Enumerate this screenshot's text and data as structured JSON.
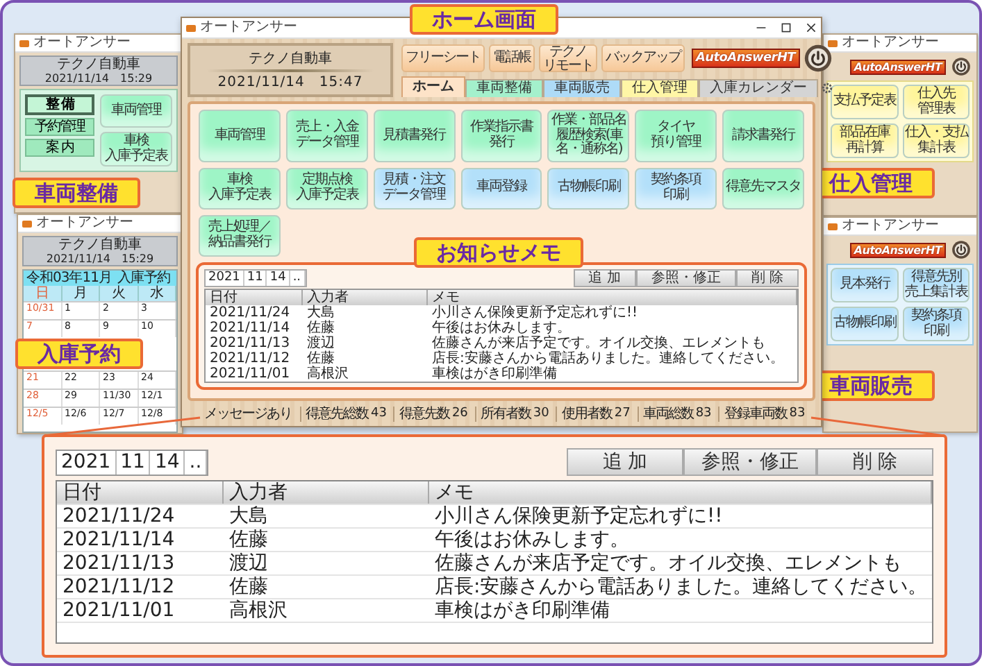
{
  "bg_windows": [
    {
      "kind": "sidebar",
      "title": "オートアンサー",
      "company": "テクノ自動車",
      "datetime": "2021/11/14　15:29",
      "menu": [
        {
          "label": "整 備",
          "selected": true
        },
        {
          "label": "予約管理",
          "selected": false
        },
        {
          "label": "案 内",
          "selected": false
        }
      ],
      "tiles": [
        {
          "lines": [
            "車両管理"
          ],
          "color": "#9ef5c6"
        },
        {
          "lines": [
            "車検",
            "入庫予定表"
          ],
          "color": "#9ef5c6"
        }
      ],
      "callout": "車両整備"
    },
    {
      "kind": "tiles",
      "title": "オートアンサー",
      "logo": "AutoAnswerHT",
      "tiles": [
        {
          "lines": [
            "支払予定表"
          ],
          "color": "#fff59a"
        },
        {
          "lines": [
            "仕入先",
            "管理表"
          ],
          "color": "#fff59a"
        },
        {
          "lines": [
            "部品在庫",
            "再計算"
          ],
          "color": "#fff59a"
        },
        {
          "lines": [
            "仕入・支払",
            "集計表"
          ],
          "color": "#fff59a"
        }
      ],
      "callout": "仕入管理"
    },
    {
      "kind": "calendar",
      "title": "オートアンサー",
      "company": "テクノ自動車",
      "datetime": "2021/11/14　15:29",
      "month": "令和03年11月",
      "label": "入庫予約",
      "weekdays": [
        "日",
        "月",
        "火",
        "水"
      ],
      "weeks": [
        [
          "10/31",
          "1",
          "2",
          "3"
        ],
        [
          "7",
          "8",
          "9",
          "10"
        ],
        [
          "21",
          "22",
          "23",
          "24"
        ],
        [
          "28",
          "29",
          "11/30",
          "12/1"
        ],
        [
          "12/5",
          "12/6",
          "12/7",
          "12/8"
        ]
      ],
      "callout": "入庫予約"
    },
    {
      "kind": "tiles",
      "title": "オートアンサー",
      "logo": "AutoAnswerHT",
      "tiles": [
        {
          "lines": [
            "見本発行"
          ],
          "color": "#b3e0fa"
        },
        {
          "lines": [
            "得意先別",
            "売上集計表"
          ],
          "color": "#b3e0fa"
        },
        {
          "lines": [
            "古物帳印刷"
          ],
          "color": "#b3e0fa"
        },
        {
          "lines": [
            "契約条項",
            "印刷"
          ],
          "color": "#b3e0fa"
        }
      ],
      "callout": "車両販売"
    }
  ],
  "main_window": {
    "callout": "ホーム画面",
    "title": "オートアンサー",
    "company": "テクノ自動車",
    "datetime": "2021/11/14　15:47",
    "toolbar_buttons": [
      [
        "フリーシート"
      ],
      [
        "電話帳"
      ],
      [
        "テクノ",
        "リモート"
      ],
      [
        "バックアップ"
      ]
    ],
    "logo": "AutoAnswerHT",
    "tabs": [
      {
        "label": "ホーム",
        "selected": true,
        "color": "#fde3c8"
      },
      {
        "label": "車両整備",
        "selected": false,
        "color": "#a4f0cc"
      },
      {
        "label": "車両販売",
        "selected": false,
        "color": "#aedbf7"
      },
      {
        "label": "仕入管理",
        "selected": false,
        "color": "#fff6a6"
      },
      {
        "label": "入庫カレンダー",
        "selected": false,
        "color": "#d4d4d4"
      }
    ],
    "tiles": [
      {
        "lines": [
          "車両管理"
        ],
        "color": "#9ef5c6"
      },
      {
        "lines": [
          "売上・入金",
          "データ管理"
        ],
        "color": "#9ef5c6"
      },
      {
        "lines": [
          "見積書発行"
        ],
        "color": "#9ef5c6"
      },
      {
        "lines": [
          "作業指示書",
          "発行"
        ],
        "color": "#9ef5c6"
      },
      {
        "lines": [
          "作業・部品名",
          "履歴検索(車",
          "名・通称名)"
        ],
        "color": "#9ef5c6"
      },
      {
        "lines": [
          "タイヤ",
          "預り管理"
        ],
        "color": "#9ef5c6"
      },
      {
        "lines": [
          "請求書発行"
        ],
        "color": "#9ef5c6"
      },
      {
        "lines": [
          "車検",
          "入庫予定表"
        ],
        "color": "#9ef5c6"
      },
      {
        "lines": [
          "定期点検",
          "入庫予定表"
        ],
        "color": "#9ef5c6"
      },
      {
        "lines": [
          "見積・注文",
          "データ管理"
        ],
        "color": "#b3e0fa"
      },
      {
        "lines": [
          "車両登録"
        ],
        "color": "#b3e0fa"
      },
      {
        "lines": [
          "古物帳印刷"
        ],
        "color": "#b3e0fa"
      },
      {
        "lines": [
          "契約条項",
          "印刷"
        ],
        "color": "#b3e0fa"
      },
      {
        "lines": [
          "得意先マスタ"
        ],
        "color": "#9ef5c6"
      },
      {
        "lines": [
          "売上処理／",
          "納品書発行"
        ],
        "color": "#9ef5c6"
      }
    ],
    "memo": {
      "callout": "お知らせメモ",
      "date_parts": [
        "2021",
        "11",
        "14",
        ".."
      ],
      "buttons": [
        "追 加",
        "参照・修正",
        "削 除"
      ],
      "columns": [
        "日付",
        "入力者",
        "メモ"
      ],
      "rows": [
        {
          "date": "2021/11/24",
          "user": "大島",
          "memo": "小川さん保険更新予定忘れずに!!"
        },
        {
          "date": "2021/11/14",
          "user": "佐藤",
          "memo": "午後はお休みします。"
        },
        {
          "date": "2021/11/13",
          "user": "渡辺",
          "memo": "佐藤さんが来店予定です。オイル交換、エレメントも"
        },
        {
          "date": "2021/11/12",
          "user": "佐藤",
          "memo": "店長:安藤さんから電話ありました。連絡してください。"
        },
        {
          "date": "2021/11/01",
          "user": "高根沢",
          "memo": "車検はがき印刷準備"
        }
      ]
    },
    "status": {
      "message": "メッセージあり",
      "counts": [
        {
          "label": "得意先総数",
          "value": "43"
        },
        {
          "label": "得意先数",
          "value": "26"
        },
        {
          "label": "所有者数",
          "value": "30"
        },
        {
          "label": "使用者数",
          "value": "27"
        },
        {
          "label": "車両総数",
          "value": "83"
        },
        {
          "label": "登録車両数",
          "value": "83"
        }
      ]
    }
  },
  "memo_zoom": {
    "date_parts": [
      "2021",
      "11",
      "14",
      ".."
    ],
    "buttons": [
      "追 加",
      "参照・修正",
      "削 除"
    ],
    "columns": [
      "日付",
      "入力者",
      "メモ"
    ],
    "rows": [
      {
        "date": "2021/11/24",
        "user": "大島",
        "memo": "小川さん保険更新予定忘れずに!!"
      },
      {
        "date": "2021/11/14",
        "user": "佐藤",
        "memo": "午後はお休みします。"
      },
      {
        "date": "2021/11/13",
        "user": "渡辺",
        "memo": "佐藤さんが来店予定です。オイル交換、エレメントも"
      },
      {
        "date": "2021/11/12",
        "user": "佐藤",
        "memo": "店長:安藤さんから電話ありました。連絡してください。"
      },
      {
        "date": "2021/11/01",
        "user": "高根沢",
        "memo": "車検はがき印刷準備"
      }
    ]
  }
}
